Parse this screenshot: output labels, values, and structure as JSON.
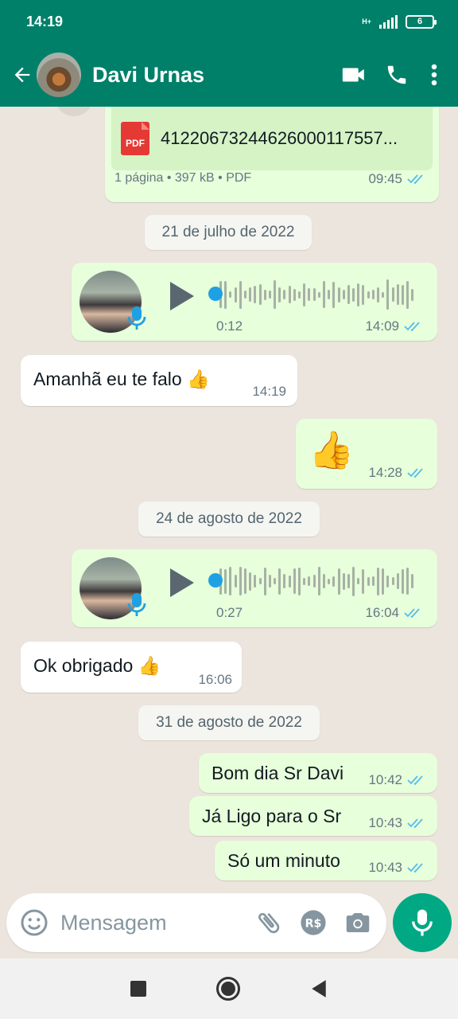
{
  "status_bar": {
    "time": "14:19",
    "network": "H+",
    "battery": "6"
  },
  "header": {
    "contact_name": "Davi Urnas",
    "icons": [
      "back-arrow-icon",
      "video-call-icon",
      "phone-icon",
      "more-options-icon"
    ]
  },
  "messages": {
    "pdf": {
      "file_name": "41220673244626000117557...",
      "icon_label": "PDF",
      "details": "1 página • 397 kB • PDF",
      "time": "09:45"
    },
    "date_1": "21 de julho de 2022",
    "voice_1": {
      "duration": "0:12",
      "time": "14:09"
    },
    "in_1": {
      "text": "Amanhã eu te falo 👍",
      "time": "14:19"
    },
    "out_thumb": {
      "text": "👍",
      "time": "14:28"
    },
    "date_2": "24 de agosto de 2022",
    "voice_2": {
      "duration": "0:27",
      "time": "16:04"
    },
    "in_2": {
      "text": "Ok obrigado 👍",
      "time": "16:06"
    },
    "date_3": "31 de agosto de 2022",
    "out_1": {
      "text": "Bom dia Sr Davi",
      "time": "10:42"
    },
    "out_2": {
      "text": "Já Ligo para o Sr",
      "time": "10:43"
    },
    "out_3": {
      "text": "Só um minuto",
      "time": "10:43"
    }
  },
  "input": {
    "placeholder": "Mensagem",
    "icons": [
      "emoji-icon",
      "attach-icon",
      "payment-icon",
      "camera-icon",
      "mic-icon"
    ]
  },
  "colors": {
    "header": "#008069",
    "bubble_out": "#e7ffdb",
    "bubble_in": "#ffffff",
    "read_ticks": "#53bdeb",
    "mic_button": "#00a884"
  }
}
